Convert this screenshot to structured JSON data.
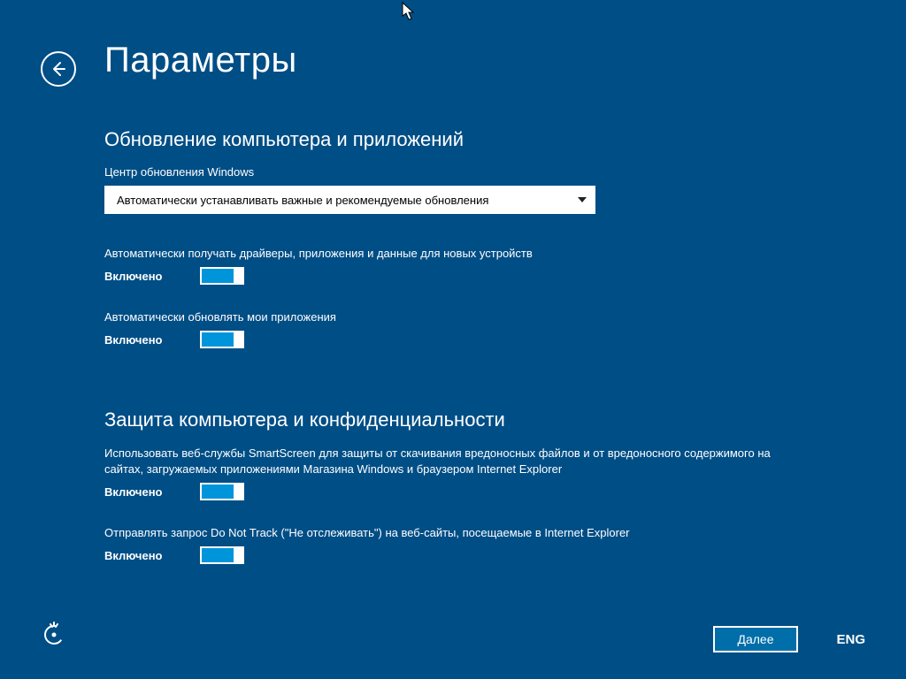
{
  "header": {
    "title": "Параметры"
  },
  "section1": {
    "heading": "Обновление компьютера и приложений",
    "dropdown_label": "Центр обновления Windows",
    "dropdown_value": "Автоматически устанавливать важные и рекомендуемые обновления",
    "opt1": {
      "desc": "Автоматически получать драйверы, приложения и данные для новых устройств",
      "state": "Включено"
    },
    "opt2": {
      "desc": "Автоматически обновлять мои приложения",
      "state": "Включено"
    }
  },
  "section2": {
    "heading": "Защита компьютера и конфиденциальности",
    "opt1": {
      "desc": "Использовать веб-службы SmartScreen для защиты от скачивания вредоносных файлов и от вредоносного содержимого на сайтах, загружаемых приложениями Магазина Windows и браузером Internet Explorer",
      "state": "Включено"
    },
    "opt2": {
      "desc": "Отправлять запрос Do Not Track (\"Не отслеживать\") на веб-сайты, посещаемые в Internet Explorer",
      "state": "Включено"
    }
  },
  "footer": {
    "next": "Далее",
    "lang": "ENG"
  }
}
